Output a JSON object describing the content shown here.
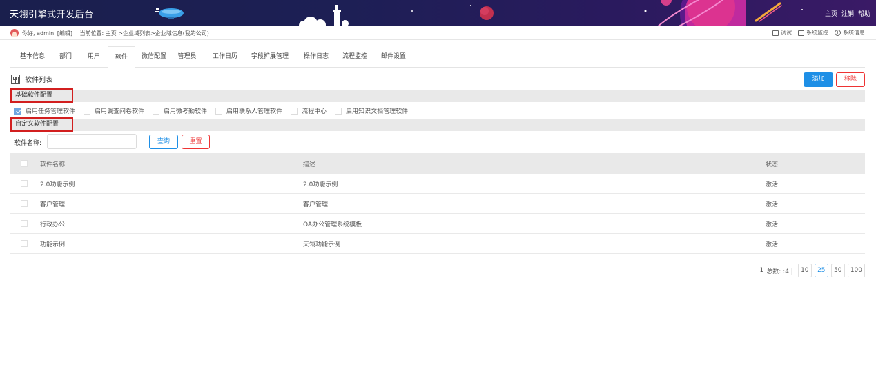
{
  "app": {
    "title": "天翎引擎式开发后台"
  },
  "topnav": {
    "home": "主页",
    "logout": "注销",
    "help": "帮助"
  },
  "info": {
    "greeting": "你好, admin",
    "edit": "[编辑]",
    "location": "当前位置: 主页 >企业域列表>企业域信息(我的公司)"
  },
  "tools": {
    "debug": "调试",
    "monitor": "系统监控",
    "sysinfo": "系统信息"
  },
  "tabs": [
    "基本信息",
    "部门",
    "用户",
    "软件",
    "微信配置",
    "管理员",
    "工作日历",
    "字段扩展管理",
    "操作日志",
    "流程监控",
    "邮件设置"
  ],
  "active_tab": "软件",
  "list": {
    "title": "软件列表",
    "add": "添加",
    "remove": "移除"
  },
  "basic": {
    "label": "基础软件配置",
    "options": [
      {
        "label": "启用任务管理软件",
        "checked": true
      },
      {
        "label": "启用调查问卷软件",
        "checked": false
      },
      {
        "label": "启用微考勤软件",
        "checked": false
      },
      {
        "label": "启用联系人管理软件",
        "checked": false
      },
      {
        "label": "流程中心",
        "checked": false
      },
      {
        "label": "启用知识文档管理软件",
        "checked": false
      }
    ]
  },
  "custom": {
    "label": "自定义软件配置"
  },
  "search": {
    "label": "软件名称:",
    "value": "",
    "placeholder": "",
    "query": "查询",
    "reset": "重置"
  },
  "table": {
    "headers": {
      "name": "软件名称",
      "desc": "描述",
      "status": "状态"
    },
    "rows": [
      {
        "name": "2.0功能示例",
        "desc": "2.0功能示例",
        "status": "激活"
      },
      {
        "name": "客户管理",
        "desc": "客户管理",
        "status": "激活"
      },
      {
        "name": "行政办公",
        "desc": "OA办公管理系统模板",
        "status": "激活"
      },
      {
        "name": "功能示例",
        "desc": "天翎功能示例",
        "status": "激活"
      }
    ]
  },
  "pager": {
    "page": "1",
    "total": "总数: :4 |",
    "sizes": [
      "10",
      "25",
      "50",
      "100"
    ],
    "active_size": "25"
  },
  "colors": {
    "primary": "#1e8fe6",
    "danger": "#e33333",
    "highlight_border": "#d21f1f",
    "banner": "#1d1f55"
  }
}
